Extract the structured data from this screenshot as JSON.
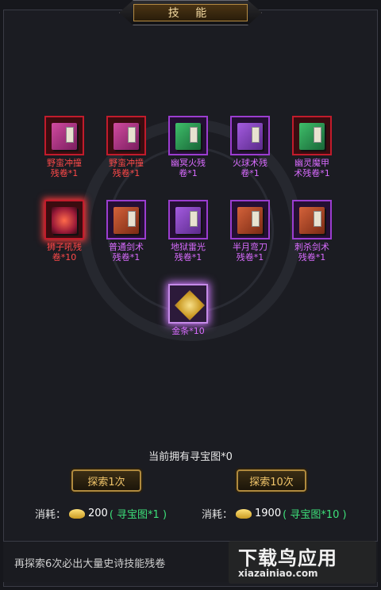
{
  "title": "技 能",
  "rewards": [
    {
      "label": "野蛮冲撞\n残卷*1",
      "color": "red",
      "icon": "magenta-skill-book-icon"
    },
    {
      "label": "野蛮冲撞\n残卷*1",
      "color": "red",
      "icon": "magenta-skill-book-icon"
    },
    {
      "label": "幽冥火残\n卷*1",
      "color": "purple",
      "icon": "green-skill-book-icon"
    },
    {
      "label": "火球术残\n卷*1",
      "color": "purple",
      "icon": "violet-skill-book-icon"
    },
    {
      "label": "幽灵魔甲\n术残卷*1",
      "color": "purple",
      "icon": "green-skill-book-icon"
    },
    {
      "label": "狮子吼残\n卷*10",
      "color": "red",
      "icon": "fire-skill-book-icon"
    },
    {
      "label": "普通剑术\n残卷*1",
      "color": "purple",
      "icon": "orange-skill-book-icon"
    },
    {
      "label": "地狱雷光\n残卷*1",
      "color": "purple",
      "icon": "violet-skill-book-icon"
    },
    {
      "label": "半月弯刀\n残卷*1",
      "color": "purple",
      "icon": "orange-skill-book-icon"
    },
    {
      "label": "刺杀剑术\n残卷*1",
      "color": "purple",
      "icon": "orange-skill-book-icon"
    },
    {
      "label": "金条*10",
      "color": "purple",
      "icon": "gold-bar-icon"
    }
  ],
  "status": "当前拥有寻宝图*0",
  "buttons": {
    "explore1": "探索1次",
    "explore10": "探索10次"
  },
  "cost1": {
    "label": "消耗：",
    "amount": "200",
    "requirement": "( 寻宝图*1 )"
  },
  "cost10": {
    "label": "消耗：",
    "amount": "1900",
    "requirement": "( 寻宝图*10 )"
  },
  "hint": "再探索6次必出大量史诗技能残卷",
  "watermark": {
    "top": "下载鸟应用",
    "bottom": "xiazainiao.com"
  },
  "colors": {
    "label_red": "#ff4a4a",
    "label_purple": "#d96cff",
    "gold": "#f0c46a",
    "green": "#3de07a"
  }
}
